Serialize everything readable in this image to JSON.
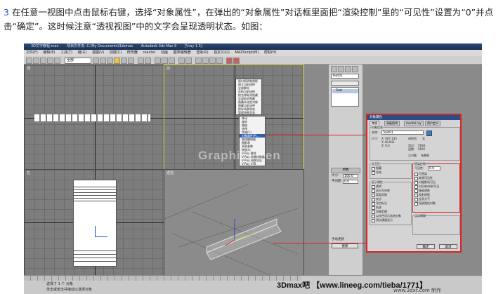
{
  "instruction": {
    "number": "3",
    "text": "在任意一视图中点击鼠标右键，选择“对象属性”，在弹出的“对象属性”对话框里面把“渲染控制”里的“可见性”设置为“0”并点击“确定”。这时候注意“透视视图”中的文字会呈现透明状态。如图："
  },
  "app": {
    "title_segments": [
      "3D文字教程.max",
      "项目文件夹: C:\\My Documents\\3dsmax",
      "Autodesk 3ds Max 9",
      "[Vray 1.5]"
    ],
    "menu": [
      "文件(F)",
      "编辑(E)",
      "工具(T)",
      "组(G)",
      "视图(V)",
      "创建(C)",
      "修改器",
      "reactor",
      "动画",
      "图表编辑器",
      "渲染(R)",
      "自定义(U)",
      "MAXScript(M)",
      "帮助(H)"
    ],
    "toolbar_select": "全部"
  },
  "viewports": {
    "top_left": "顶",
    "top_right": "前",
    "bottom_left": "左",
    "bottom_right": "透视"
  },
  "watermark": "GraphicChen",
  "context_menu": {
    "upper_items": [
      "视口照明和阴影",
      "孤立当前选择",
      "全部解冻",
      "冻结当前选择",
      "按名称取消隐藏",
      "全部取消隐藏",
      "隐藏未选定对象",
      "隐藏当前选择",
      "保存场景状态",
      "管理场景状态"
    ],
    "lower_items": [
      "移动",
      "旋转",
      "缩放",
      "选择",
      "克隆(C)",
      "对象属性(P)...",
      "曲线编辑器",
      "摄影表",
      "关联参数",
      "转换为:",
      "V-Ray 属性",
      "V-Ray 场景转换器",
      "V-Ray 网格导出",
      "V-Ray VFB"
    ],
    "highlighted": "对象属性(P)..."
  },
  "command_panel": {
    "name_field": "Text01",
    "modifier": "Text",
    "rollout": "参数",
    "size_label": "大小:",
    "size_value": "100.0",
    "kerning_label": "字间距:",
    "kerning_value": "0.0",
    "options": [
      "手动更新",
      "更新"
    ]
  },
  "dialog": {
    "title": "对象属性",
    "tabs": [
      "常规",
      "高级照明",
      "mental ray",
      "用户定义"
    ],
    "section_info": "对象信息",
    "name_label": "名称:",
    "name_value": "Text01",
    "dims_label": "尺寸:",
    "dims": [
      "X: 697.135",
      "Y: 40.043",
      "Z: 0.0"
    ],
    "material_label": "材质名:",
    "material_value": "无",
    "vertices_label": "顶点:",
    "vertices_value": "5694",
    "faces_label": "面数:",
    "faces_value": "5692",
    "parent_label": "父对象:",
    "parent_value": "场景根",
    "section_interaction": "交互性",
    "interaction_items": [
      "隐藏",
      "冻结"
    ],
    "section_display": "显示属性",
    "display_items": [
      "透明",
      "显示为外框",
      "背面消隐",
      "仅边",
      "顶点标记",
      "轨迹",
      "忽略范围",
      "以灰色显示冻结对象",
      "顶点通道显示"
    ],
    "section_render": "渲染控制",
    "visibility_label": "可见性:",
    "visibility_value": "0.0",
    "render_items": [
      "可渲染",
      "继承可见性",
      "对摄影机可见",
      "对反射/折射可见",
      "接收阴影",
      "投射阴影",
      "应用大气",
      "渲染阻挡对象"
    ],
    "section_motion": "运动模糊",
    "ok_label": "确定",
    "cancel_label": "取消"
  },
  "status": {
    "line1": "选择了 1 个 对象",
    "line2": "单击或单击并拖动以选择对象"
  },
  "credit": "3Dmax吧 【www.lineeg.com/tieba/1771】",
  "credit_small": "www.3dxt.com 制作"
}
